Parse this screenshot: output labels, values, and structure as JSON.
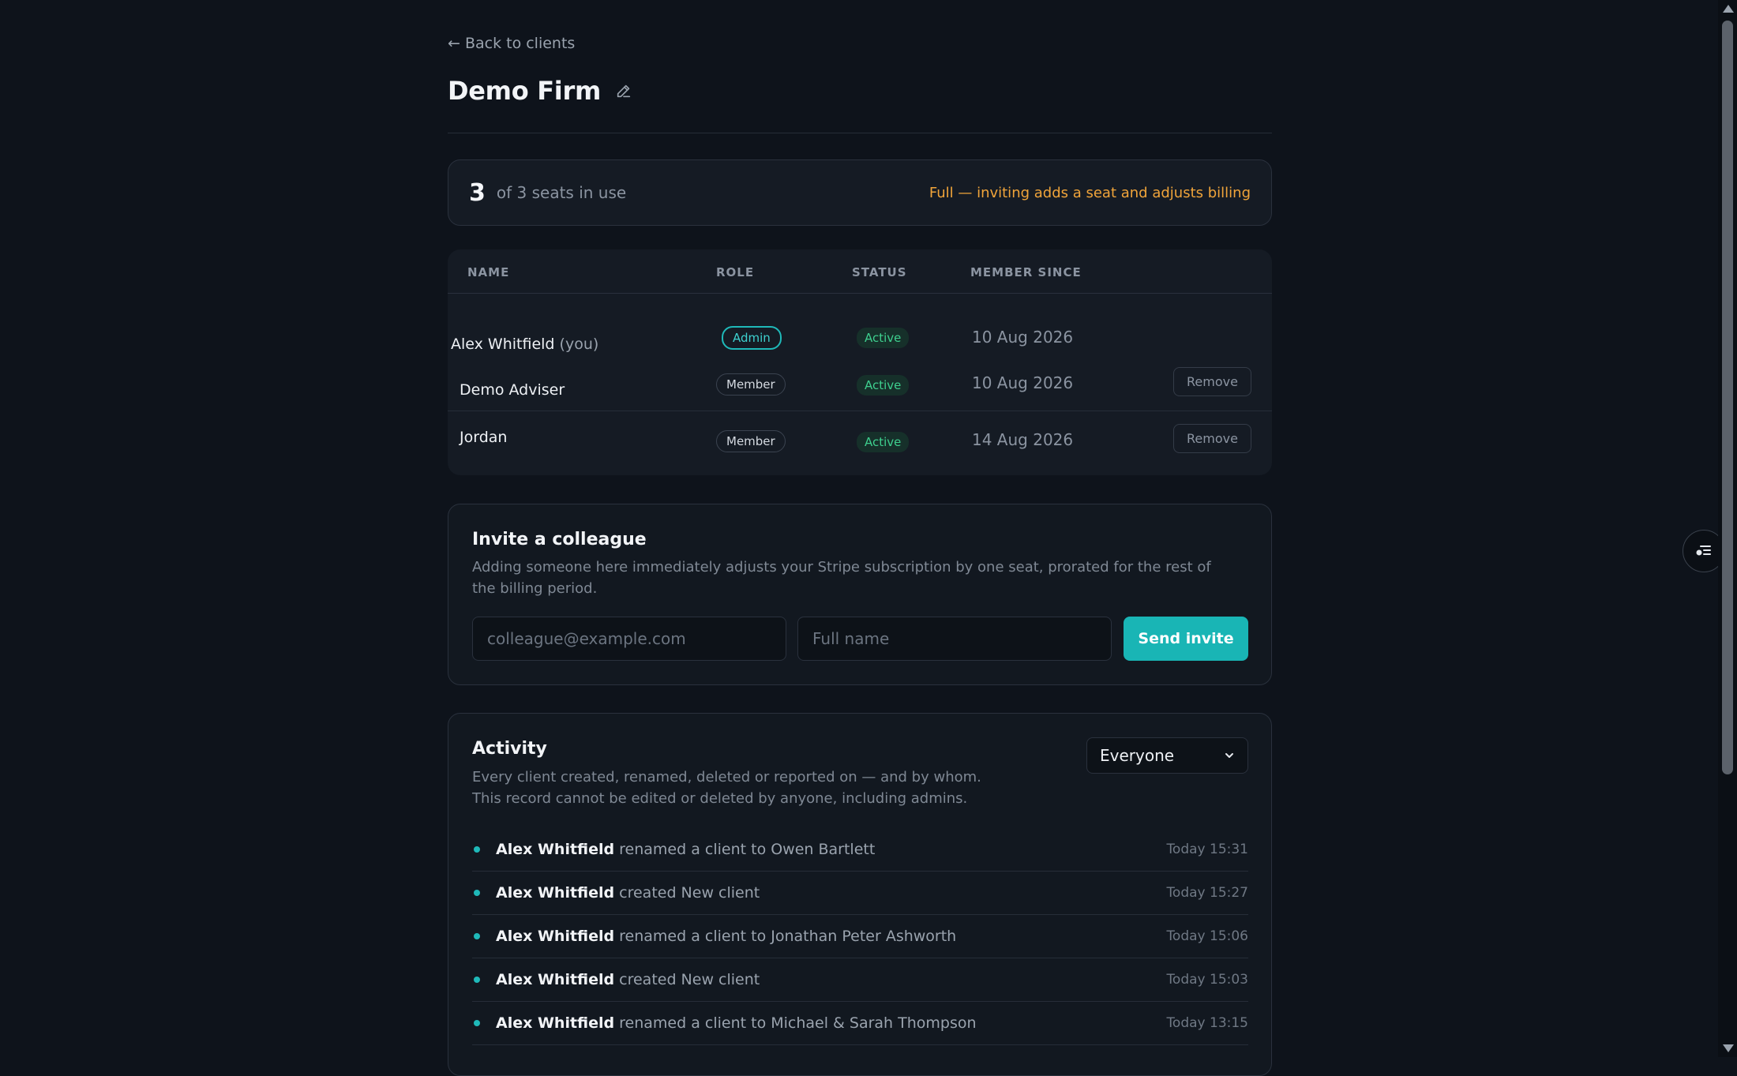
{
  "nav": {
    "back_label": "← Back to clients"
  },
  "header": {
    "title": "Demo Firm"
  },
  "seats": {
    "count": "3",
    "text": "of 3 seats in use",
    "warning": "Full — inviting adds a seat and adjusts billing"
  },
  "members": {
    "columns": [
      "NAME",
      "ROLE",
      "STATUS",
      "MEMBER SINCE"
    ],
    "rows": [
      {
        "name": "Alex Whitfield",
        "you": "(you)",
        "role": "Admin",
        "status": "Active",
        "since": "10 Aug 2026"
      },
      {
        "name": "Demo Adviser",
        "role": "Member",
        "status": "Active",
        "since": "10 Aug 2026",
        "action": "Remove"
      },
      {
        "name": "Jordan",
        "role": "Member",
        "status": "Active",
        "since": "14 Aug 2026",
        "action": "Remove"
      }
    ]
  },
  "invite": {
    "title": "Invite a colleague",
    "description": "Adding someone here immediately adjusts your Stripe subscription by one seat, prorated for the rest of the billing period.",
    "email_placeholder": "colleague@example.com",
    "name_placeholder": "Full name",
    "send_label": "Send invite"
  },
  "activity": {
    "title": "Activity",
    "description": "Every client created, renamed, deleted or reported on — and by whom. This record cannot be edited or deleted by anyone, including admins.",
    "filter": "Everyone",
    "items": [
      {
        "user": "Alex Whitfield",
        "text": "renamed a client to Owen Bartlett",
        "time": "Today 15:31"
      },
      {
        "user": "Alex Whitfield",
        "text": "created New client",
        "time": "Today 15:27"
      },
      {
        "user": "Alex Whitfield",
        "text": "renamed a client to Jonathan Peter Ashworth",
        "time": "Today 15:06"
      },
      {
        "user": "Alex Whitfield",
        "text": "created New client",
        "time": "Today 15:03"
      },
      {
        "user": "Alex Whitfield",
        "text": "renamed a client to Michael & Sarah Thompson",
        "time": "Today 13:15"
      }
    ]
  },
  "colors": {
    "accent": "#19b5b5",
    "warning": "#f0a43a",
    "success": "#3ecf8e",
    "background": "#0e131b"
  }
}
